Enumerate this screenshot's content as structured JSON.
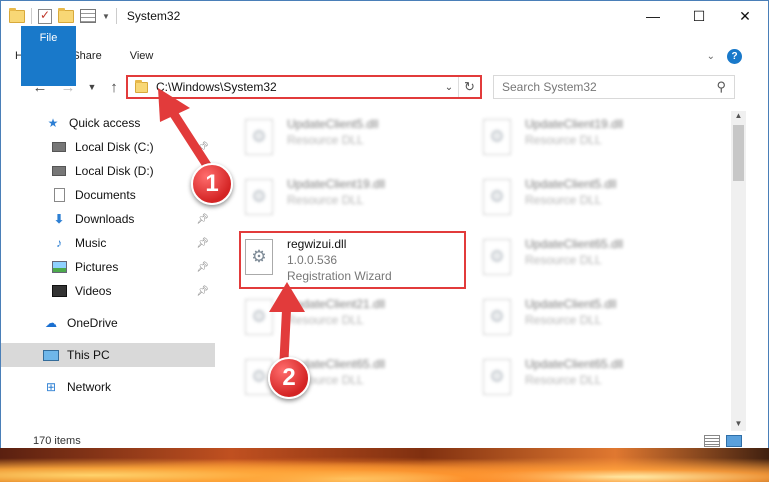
{
  "window": {
    "title": "System32",
    "controls": {
      "minimize": "—",
      "maximize": "☐",
      "close": "✕"
    }
  },
  "ribbon": {
    "tabs": [
      "File",
      "Home",
      "Share",
      "View"
    ]
  },
  "address_bar": {
    "path": "C:\\Windows\\System32",
    "refresh_icon": "↻"
  },
  "search": {
    "placeholder": "Search System32"
  },
  "sidebar": {
    "items": [
      {
        "label": "Quick access",
        "icon": "star-icon"
      },
      {
        "label": "Local Disk (C:)",
        "icon": "drive-icon",
        "pinned": true
      },
      {
        "label": "Local Disk (D:)",
        "icon": "drive-icon"
      },
      {
        "label": "Documents",
        "icon": "document-icon",
        "pinned": true
      },
      {
        "label": "Downloads",
        "icon": "download-icon",
        "pinned": true
      },
      {
        "label": "Music",
        "icon": "music-icon",
        "pinned": true
      },
      {
        "label": "Pictures",
        "icon": "pictures-icon",
        "pinned": true
      },
      {
        "label": "Videos",
        "icon": "video-icon",
        "pinned": true
      },
      {
        "label": "OneDrive",
        "icon": "cloud-icon"
      },
      {
        "label": "This PC",
        "icon": "computer-icon",
        "selected": true
      },
      {
        "label": "Network",
        "icon": "network-icon"
      }
    ]
  },
  "files": [
    {
      "name": "UpdateClient5.dll",
      "type": "Resource DLL"
    },
    {
      "name": "UpdateClient19.dll",
      "type": "Resource DLL"
    },
    {
      "name": "UpdateClient19.dll",
      "type": "Resource DLL"
    },
    {
      "name": "UpdateClient5.dll",
      "type": "Resource DLL"
    },
    {
      "name": "regwizui.dll",
      "version": "1.0.0.536",
      "type": "Registration Wizard",
      "highlighted": true
    },
    {
      "name": "UpdateClient65.dll",
      "type": "Resource DLL"
    },
    {
      "name": "UpdateClient21.dll",
      "type": "Resource DLL"
    },
    {
      "name": "UpdateClient5.dll",
      "type": "Resource DLL"
    },
    {
      "name": "UpdateClient65.dll",
      "type": "Resource DLL"
    },
    {
      "name": "UpdateClient65.dll",
      "type": "Resource DLL"
    }
  ],
  "status": {
    "item_count": "170 items"
  },
  "callouts": [
    "1",
    "2"
  ],
  "colors": {
    "accent": "#1979ca",
    "highlight": "#e23b3b"
  }
}
